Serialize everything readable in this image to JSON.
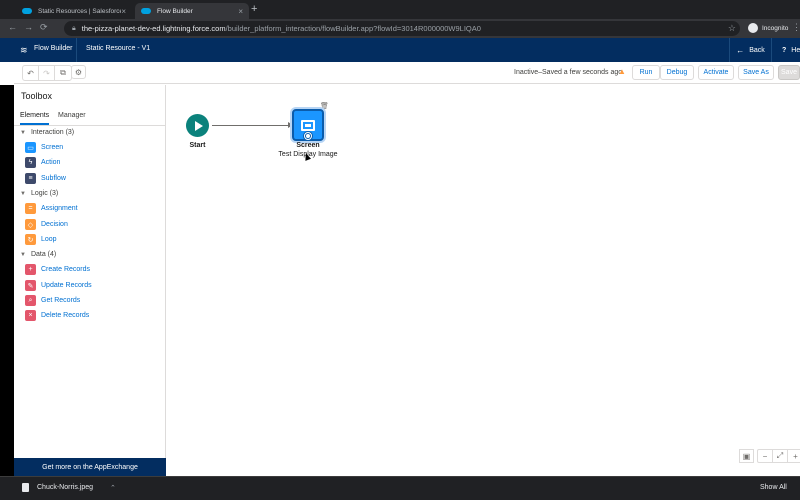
{
  "browser": {
    "tabs": [
      {
        "title": "Static Resources | Salesforce",
        "close": "×"
      },
      {
        "title": "Flow Builder",
        "close": "×"
      }
    ],
    "new_tab": "+",
    "nav": {
      "back": "←",
      "forward": "→",
      "reload": "⟳"
    },
    "url_host": "the-pizza-planet-dev-ed.lightning.force.com",
    "url_path": "/builder_platform_interaction/flowBuilder.app?flowId=3014R000000W9LIQA0",
    "profile": "Incognito"
  },
  "header": {
    "app_name": "Flow Builder",
    "flow_title": "Static Resource - V1",
    "back_label": "Back",
    "help_label": "He"
  },
  "toolbar": {
    "status": "Inactive–Saved a few seconds ago",
    "buttons": [
      "Run",
      "Debug",
      "Activate",
      "Save As",
      "Save"
    ]
  },
  "toolbox": {
    "title": "Toolbox",
    "tabs": [
      "Elements",
      "Manager"
    ],
    "sections": [
      {
        "label": "Interaction (3)",
        "items": [
          {
            "label": "Screen",
            "icon": "screen-icon",
            "color": "#1b96ff"
          },
          {
            "label": "Action",
            "icon": "action-icon",
            "color": "#3e4a6b"
          },
          {
            "label": "Subflow",
            "icon": "subflow-icon",
            "color": "#3e4a6b"
          }
        ]
      },
      {
        "label": "Logic (3)",
        "items": [
          {
            "label": "Assignment",
            "icon": "assignment-icon",
            "color": "#ff9a3c"
          },
          {
            "label": "Decision",
            "icon": "decision-icon",
            "color": "#ff9a3c"
          },
          {
            "label": "Loop",
            "icon": "loop-icon",
            "color": "#ff9a3c"
          }
        ]
      },
      {
        "label": "Data (4)",
        "items": [
          {
            "label": "Create Records",
            "icon": "create-records-icon",
            "color": "#e3566b"
          },
          {
            "label": "Update Records",
            "icon": "update-records-icon",
            "color": "#e3566b"
          },
          {
            "label": "Get Records",
            "icon": "get-records-icon",
            "color": "#e3566b"
          },
          {
            "label": "Delete Records",
            "icon": "delete-records-icon",
            "color": "#e3566b"
          }
        ]
      }
    ],
    "footer": "Get more on the AppExchange"
  },
  "canvas": {
    "start_label": "Start",
    "screen_label": "Screen",
    "screen_sublabel": "Test Display Image"
  },
  "downloads": {
    "file": "Chuck-Norris.jpeg",
    "show_all": "Show All"
  }
}
